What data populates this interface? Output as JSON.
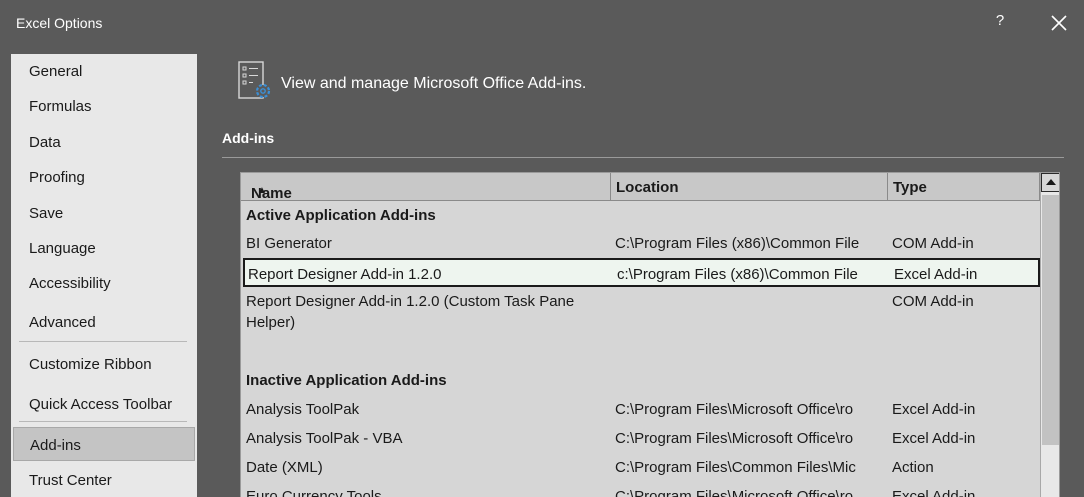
{
  "window": {
    "title": "Excel Options",
    "help": "?"
  },
  "sidebar": {
    "items": [
      {
        "label": "General"
      },
      {
        "label": "Formulas"
      },
      {
        "label": "Data"
      },
      {
        "label": "Proofing"
      },
      {
        "label": "Save"
      },
      {
        "label": "Language"
      },
      {
        "label": "Accessibility"
      },
      {
        "label": "Advanced"
      },
      {
        "label": "Customize Ribbon"
      },
      {
        "label": "Quick Access Toolbar"
      },
      {
        "label": "Add-ins"
      },
      {
        "label": "Trust Center"
      }
    ],
    "selected": "Add-ins"
  },
  "main": {
    "header_icon": "addins-gear-icon",
    "header": "View and manage Microsoft Office Add-ins.",
    "section": "Add-ins",
    "table": {
      "columns": [
        "Name",
        "Location",
        "Type"
      ],
      "sort_indicator": "▲",
      "groups": [
        {
          "title": "Active Application Add-ins",
          "rows": [
            {
              "name": "BI Generator",
              "location": "C:\\Program Files (x86)\\Common File",
              "type": "COM Add-in"
            },
            {
              "name": "Report Designer Add-in 1.2.0",
              "location": "c:\\Program Files (x86)\\Common File",
              "type": "Excel Add-in"
            },
            {
              "name": "Report Designer Add-in 1.2.0 (Custom Task Pane Helper)",
              "location": "",
              "type": "COM Add-in"
            }
          ]
        },
        {
          "title": "Inactive Application Add-ins",
          "rows": [
            {
              "name": "Analysis ToolPak",
              "location": "C:\\Program Files\\Microsoft Office\\ro",
              "type": "Excel Add-in"
            },
            {
              "name": "Analysis ToolPak - VBA",
              "location": "C:\\Program Files\\Microsoft Office\\ro",
              "type": "Excel Add-in"
            },
            {
              "name": "Date (XML)",
              "location": "C:\\Program Files\\Common Files\\Mic",
              "type": "Action"
            },
            {
              "name": "Euro Currency Tools",
              "location": "C:\\Program Files\\Microsoft Office\\ro",
              "type": "Excel Add-in"
            }
          ]
        }
      ]
    }
  },
  "colors": {
    "background": "#5a5a5a",
    "sidebar": "#e8e8e8",
    "selected_nav": "#c4c4c4",
    "table": "#d6d6d6",
    "selected_row": "#eef5ef",
    "gear_accent": "#3b8fd6"
  }
}
